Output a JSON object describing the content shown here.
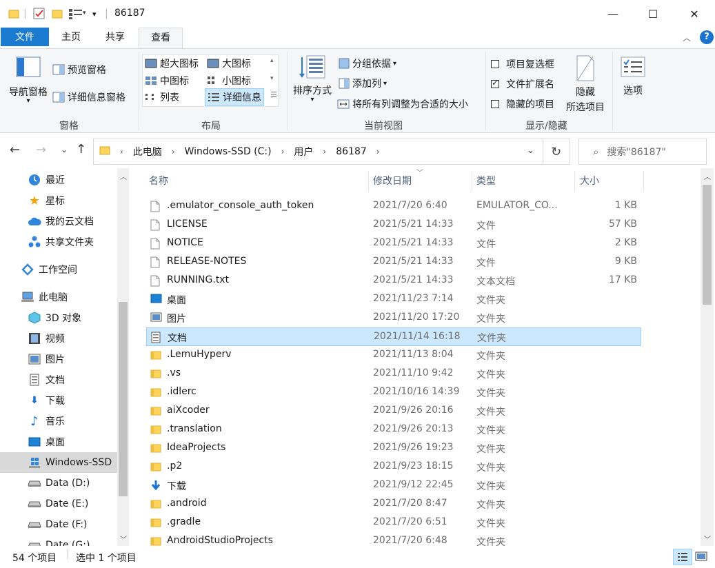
{
  "window": {
    "title": "86187",
    "minimize": "—",
    "maximize": "☐",
    "close": "✕"
  },
  "ribbon_tabs": [
    "文件",
    "主页",
    "共享",
    "查看"
  ],
  "ribbon": {
    "panes": {
      "nav_pane": "导航窗格",
      "preview_pane": "预览窗格",
      "details_pane": "详细信息窗格",
      "group_label": "窗格"
    },
    "layout": {
      "extra_large": "超大图标",
      "large": "大图标",
      "medium": "中图标",
      "small": "小图标",
      "list": "列表",
      "details": "详细信息",
      "group_label": "布局"
    },
    "current_view": {
      "sort_by": "排序方式",
      "group_by": "分组依据",
      "add_column": "添加列",
      "fit_columns": "将所有列调整为合适的大小",
      "group_label": "当前视图"
    },
    "show_hide": {
      "item_checkboxes": "项目复选框",
      "file_extensions": "文件扩展名",
      "hidden_items": "隐藏的项目",
      "hide_selected_line1": "隐藏",
      "hide_selected_line2": "所选项目",
      "group_label": "显示/隐藏",
      "item_checkboxes_checked": false,
      "file_extensions_checked": true,
      "hidden_items_checked": false
    },
    "options": "选项"
  },
  "address": {
    "crumbs": [
      "此电脑",
      "Windows-SSD (C:)",
      "用户",
      "86187"
    ],
    "search_placeholder": "搜索\"86187\""
  },
  "sidebar": {
    "items": [
      {
        "label": "最近",
        "icon": "clock-icon"
      },
      {
        "label": "星标",
        "icon": "star-icon"
      },
      {
        "label": "我的云文档",
        "icon": "cloud-icon"
      },
      {
        "label": "共享文件夹",
        "icon": "share-icon"
      },
      {
        "label": "工作空间",
        "icon": "workspace-icon"
      },
      {
        "label": "此电脑",
        "icon": "computer-icon"
      },
      {
        "label": "3D 对象",
        "icon": "cube-icon"
      },
      {
        "label": "视频",
        "icon": "video-icon"
      },
      {
        "label": "图片",
        "icon": "picture-icon"
      },
      {
        "label": "文档",
        "icon": "document-icon"
      },
      {
        "label": "下载",
        "icon": "download-icon"
      },
      {
        "label": "音乐",
        "icon": "music-icon"
      },
      {
        "label": "桌面",
        "icon": "desktop-icon"
      },
      {
        "label": "Windows-SSD",
        "icon": "windows-drive-icon"
      },
      {
        "label": "Data (D:)",
        "icon": "drive-icon"
      },
      {
        "label": "Date (E:)",
        "icon": "drive-icon"
      },
      {
        "label": "Date (F:)",
        "icon": "drive-icon"
      },
      {
        "label": "Date (G:)",
        "icon": "drive-icon"
      }
    ]
  },
  "columns": [
    "名称",
    "修改日期",
    "类型",
    "大小"
  ],
  "files": [
    {
      "name": ".emulator_console_auth_token",
      "date": "2021/7/20 6:40",
      "type": "EMULATOR_CO...",
      "size": "1 KB",
      "icon": "file-icon"
    },
    {
      "name": "LICENSE",
      "date": "2021/5/21 14:33",
      "type": "文件",
      "size": "57 KB",
      "icon": "file-icon"
    },
    {
      "name": "NOTICE",
      "date": "2021/5/21 14:33",
      "type": "文件",
      "size": "2 KB",
      "icon": "file-icon"
    },
    {
      "name": "RELEASE-NOTES",
      "date": "2021/5/21 14:33",
      "type": "文件",
      "size": "9 KB",
      "icon": "file-icon"
    },
    {
      "name": "RUNNING.txt",
      "date": "2021/5/21 14:33",
      "type": "文本文档",
      "size": "17 KB",
      "icon": "file-icon"
    },
    {
      "name": "桌面",
      "date": "2021/11/23 7:14",
      "type": "文件夹",
      "size": "",
      "icon": "desktop-icon"
    },
    {
      "name": "图片",
      "date": "2021/11/20 17:20",
      "type": "文件夹",
      "size": "",
      "icon": "picture-icon"
    },
    {
      "name": "文档",
      "date": "2021/11/14 16:18",
      "type": "文件夹",
      "size": "",
      "icon": "document-icon"
    },
    {
      "name": ".LemuHyperv",
      "date": "2021/11/13 8:04",
      "type": "文件夹",
      "size": "",
      "icon": "folder-icon"
    },
    {
      "name": ".vs",
      "date": "2021/11/10 9:42",
      "type": "文件夹",
      "size": "",
      "icon": "folder-icon"
    },
    {
      "name": ".idlerc",
      "date": "2021/10/16 14:39",
      "type": "文件夹",
      "size": "",
      "icon": "folder-icon"
    },
    {
      "name": "aiXcoder",
      "date": "2021/9/26 20:16",
      "type": "文件夹",
      "size": "",
      "icon": "folder-icon"
    },
    {
      "name": ".translation",
      "date": "2021/9/26 20:13",
      "type": "文件夹",
      "size": "",
      "icon": "folder-icon"
    },
    {
      "name": "IdeaProjects",
      "date": "2021/9/26 19:23",
      "type": "文件夹",
      "size": "",
      "icon": "folder-icon"
    },
    {
      "name": ".p2",
      "date": "2021/9/23 18:15",
      "type": "文件夹",
      "size": "",
      "icon": "folder-icon"
    },
    {
      "name": "下载",
      "date": "2021/9/12 22:45",
      "type": "文件夹",
      "size": "",
      "icon": "download-icon"
    },
    {
      "name": ".android",
      "date": "2021/7/20 8:47",
      "type": "文件夹",
      "size": "",
      "icon": "folder-icon"
    },
    {
      "name": ".gradle",
      "date": "2021/7/20 6:51",
      "type": "文件夹",
      "size": "",
      "icon": "folder-icon"
    },
    {
      "name": "AndroidStudioProjects",
      "date": "2021/7/20 6:48",
      "type": "文件夹",
      "size": "",
      "icon": "folder-icon"
    }
  ],
  "selected_file": "文档",
  "status": {
    "count": "54 个项目",
    "selection": "选中 1 个项目"
  },
  "colors": {
    "file_tab": "#1a7bd1",
    "selection": "#cce8ff",
    "selection_border": "#99d1ff",
    "ribbon_bg": "#f5f6f7",
    "help": "#1a73d1"
  }
}
